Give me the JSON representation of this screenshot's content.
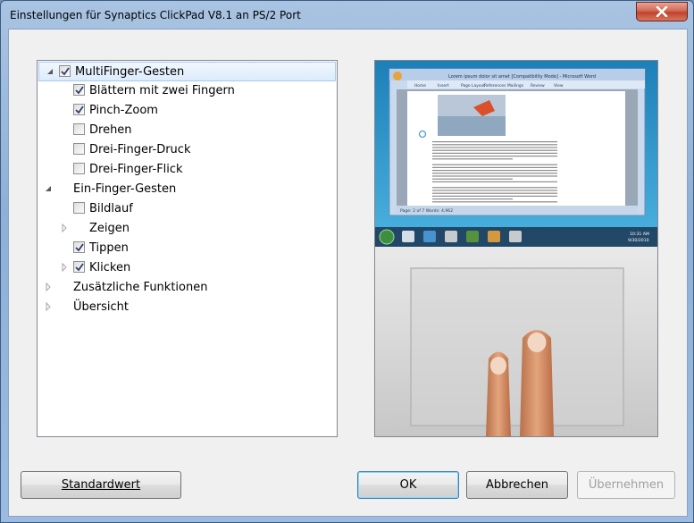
{
  "window": {
    "title": "Einstellungen für Synaptics ClickPad V8.1 an PS/2 Port"
  },
  "tree": {
    "help_label": "?",
    "items": [
      {
        "label": "MultiFinger-Gesten",
        "level": 0,
        "expander": "expanded",
        "checkbox": "checked",
        "selected": true
      },
      {
        "label": "Blättern mit zwei Fingern",
        "level": 1,
        "expander": "none",
        "checkbox": "checked"
      },
      {
        "label": "Pinch-Zoom",
        "level": 1,
        "expander": "none",
        "checkbox": "checked"
      },
      {
        "label": "Drehen",
        "level": 1,
        "expander": "none",
        "checkbox": "unchecked"
      },
      {
        "label": "Drei-Finger-Druck",
        "level": 1,
        "expander": "none",
        "checkbox": "unchecked"
      },
      {
        "label": "Drei-Finger-Flick",
        "level": 1,
        "expander": "none",
        "checkbox": "unchecked"
      },
      {
        "label": "Ein-Finger-Gesten",
        "level": 0,
        "expander": "expanded",
        "checkbox": "none"
      },
      {
        "label": "Bildlauf",
        "level": 1,
        "expander": "none",
        "checkbox": "unchecked"
      },
      {
        "label": "Zeigen",
        "level": 1,
        "expander": "collapsed",
        "checkbox": "none"
      },
      {
        "label": "Tippen",
        "level": 1,
        "expander": "none",
        "checkbox": "checked"
      },
      {
        "label": "Klicken",
        "level": 1,
        "expander": "collapsed",
        "checkbox": "checked"
      },
      {
        "label": "Zusätzliche Funktionen",
        "level": 0,
        "expander": "collapsed",
        "checkbox": "none"
      },
      {
        "label": "Übersicht",
        "level": 0,
        "expander": "collapsed",
        "checkbox": "none"
      }
    ]
  },
  "preview": {
    "document_title": "Lorem ipsum dolor sit amet [Compatibility Mode] - Microsoft Word",
    "ribbon_tabs": [
      "Home",
      "Insert",
      "Page Layout",
      "References",
      "Mailings",
      "Review",
      "View"
    ],
    "status_text": "Page: 2 of 7    Words: 4,962",
    "taskbar_time": "10:31 AM",
    "taskbar_date": "9/30/2010"
  },
  "buttons": {
    "default": "Standardwert",
    "ok": "OK",
    "cancel": "Abbrechen",
    "apply": "Übernehmen"
  }
}
